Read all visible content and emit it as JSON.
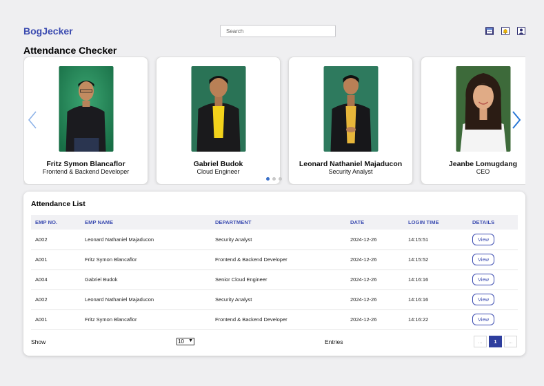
{
  "header": {
    "brand": "BogJecker",
    "search_placeholder": "Search",
    "icons": [
      "calendar-icon",
      "bell-icon",
      "profile-icon"
    ],
    "accent_color": "#3b4bb0"
  },
  "page_title": "Attendance Checker",
  "carousel": {
    "cards": [
      {
        "name": "Fritz Symon Blancaflor",
        "role": "Frontend & Backend Developer",
        "photo_bg": "#1f8a58"
      },
      {
        "name": "Gabriel Budok",
        "role": "Cloud Engineer",
        "photo_bg": "#2a7356"
      },
      {
        "name": "Leonard Nathaniel Majaducon",
        "role": "Security Analyst",
        "photo_bg": "#2e7a5e"
      },
      {
        "name": "Jeanbe Lomugdang",
        "role": "CEO",
        "photo_bg": "#3d6a3a"
      }
    ],
    "active_dot": 0,
    "dot_count": 3
  },
  "attendance": {
    "title": "Attendance List",
    "columns": [
      "EMP NO.",
      "EMP NAME",
      "DEPARTMENT",
      "DATE",
      "LOGIN TIME",
      "DETAILS"
    ],
    "rows": [
      {
        "emp_no": "A002",
        "name": "Leonard Nathaniel Majaducon",
        "department": "Security Analyst",
        "date": "2024-12-26",
        "time": "14:15:51",
        "action": "View"
      },
      {
        "emp_no": "A001",
        "name": "Fritz Symon Blancaflor",
        "department": "Frontend & Backend Developer",
        "date": "2024-12-26",
        "time": "14:15:52",
        "action": "View"
      },
      {
        "emp_no": "A004",
        "name": "Gabriel Budok",
        "department": "Senior Cloud Engineer",
        "date": "2024-12-26",
        "time": "14:16:16",
        "action": "View"
      },
      {
        "emp_no": "A002",
        "name": "Leonard Nathaniel Majaducon",
        "department": "Security Analyst",
        "date": "2024-12-26",
        "time": "14:16:16",
        "action": "View"
      },
      {
        "emp_no": "A001",
        "name": "Fritz Symon Blancaflor",
        "department": "Frontend & Backend Developer",
        "date": "2024-12-26",
        "time": "14:16:22",
        "action": "View"
      }
    ],
    "footer": {
      "show_label": "Show",
      "entries_value": "10",
      "entries_label": "Entries",
      "pager": {
        "prev": "...",
        "current": "1",
        "next": "..."
      }
    }
  }
}
